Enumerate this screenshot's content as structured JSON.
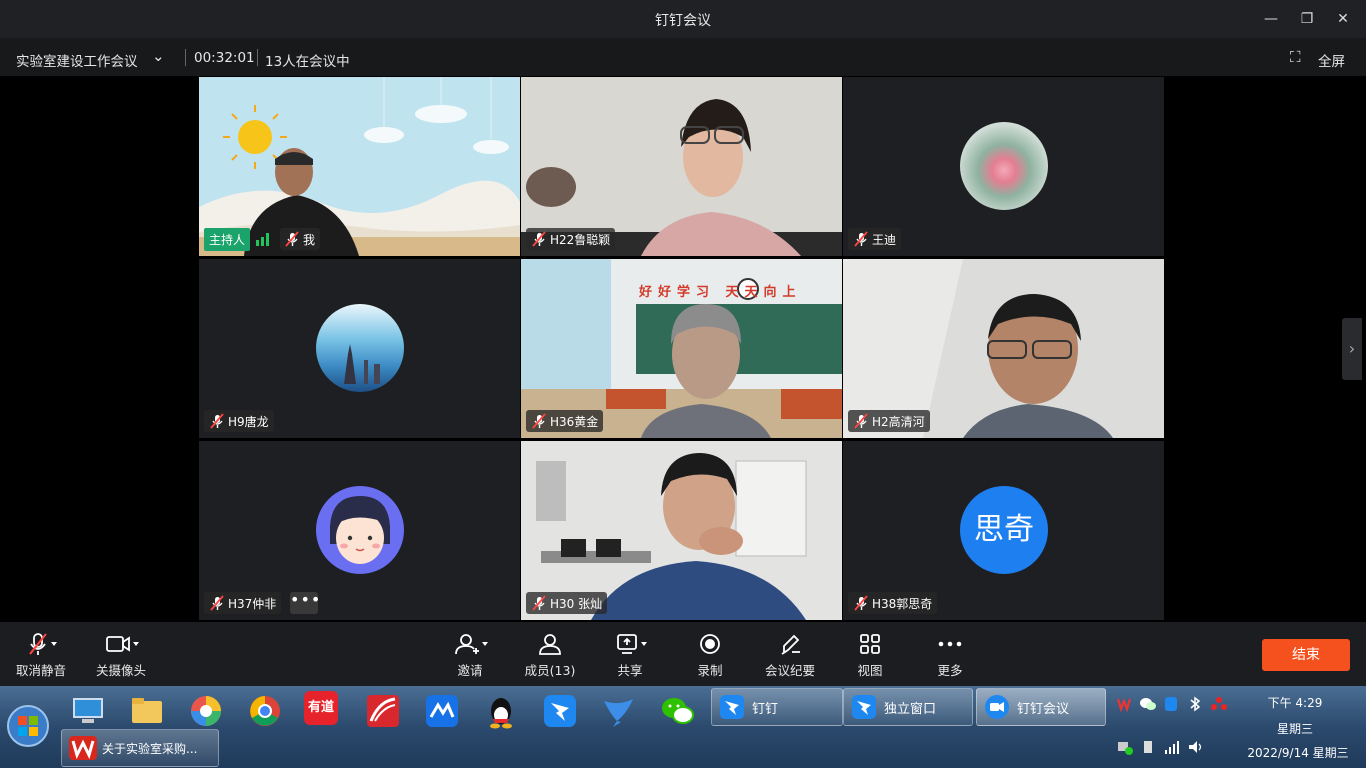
{
  "window": {
    "title": "钉钉会议"
  },
  "info": {
    "meeting_name": "实验室建设工作会议",
    "duration": "00:32:01",
    "participants_text": "13人在会议中",
    "fullscreen_label": "全屏"
  },
  "tiles": {
    "me": {
      "host_label": "主持人",
      "name": "我"
    },
    "t2": {
      "name": "H22鲁聪颖"
    },
    "t3": {
      "name": "王迪"
    },
    "t4": {
      "name": "H9唐龙"
    },
    "t5": {
      "name": "H36黄金",
      "banner": "好好学习 天天向上"
    },
    "t6": {
      "name": "H2高清河"
    },
    "t7": {
      "name": "H37仲非"
    },
    "t8": {
      "name": "H30 张灿"
    },
    "t9": {
      "name": "H38郭思奇",
      "avatar_text": "思奇"
    }
  },
  "toolbar": {
    "mute_label": "取消静音",
    "camera_label": "关摄像头",
    "invite_label": "邀请",
    "members_label": "成员(13)",
    "share_label": "共享",
    "record_label": "录制",
    "minutes_label": "会议纪要",
    "view_label": "视图",
    "more_label": "更多",
    "end_label": "结束"
  },
  "taskbar": {
    "active_doc": "关于实验室采购...",
    "youdao": "有道",
    "dingtalk_label": "钉钉",
    "standalone_label": "独立窗口",
    "meeting_label": "钉钉会议",
    "time": "下午 4:29",
    "weekday": "星期三",
    "date": "2022/9/14 星期三"
  },
  "colors": {
    "accent": "#f4511e",
    "host": "#1aa36b",
    "avatar_blue": "#1e7ff0"
  }
}
